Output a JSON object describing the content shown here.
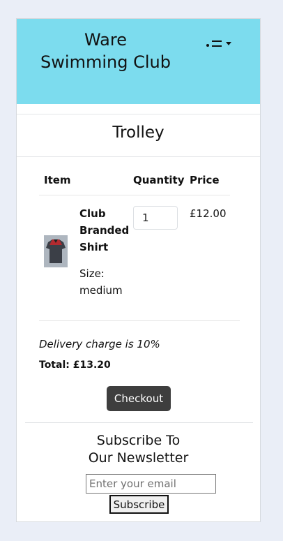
{
  "header": {
    "brand_line1": "Ware",
    "brand_line2": "Swimming Club",
    "menu_icon": "menu-toggle-icon"
  },
  "page": {
    "title": "Trolley"
  },
  "table": {
    "headers": {
      "item": "Item",
      "quantity": "Quantity",
      "price": "Price"
    },
    "rows": [
      {
        "name_line1": "Club",
        "name_line2": "Branded",
        "name_line3": "Shirt",
        "size_label": "Size:",
        "size_value": "medium",
        "quantity": "1",
        "price": "£12.00"
      }
    ]
  },
  "summary": {
    "delivery_note": "Delivery charge is 10%",
    "total": "Total: £13.20",
    "checkout_label": "Checkout"
  },
  "newsletter": {
    "heading_line1": "Subscribe To",
    "heading_line2": "Our Newsletter",
    "email_placeholder": "Enter your email",
    "subscribe_label": "Subscribe"
  },
  "colors": {
    "header_bg": "#7cdcee",
    "page_bg": "#eaeef7",
    "checkout_bg": "#3e3e3e"
  }
}
